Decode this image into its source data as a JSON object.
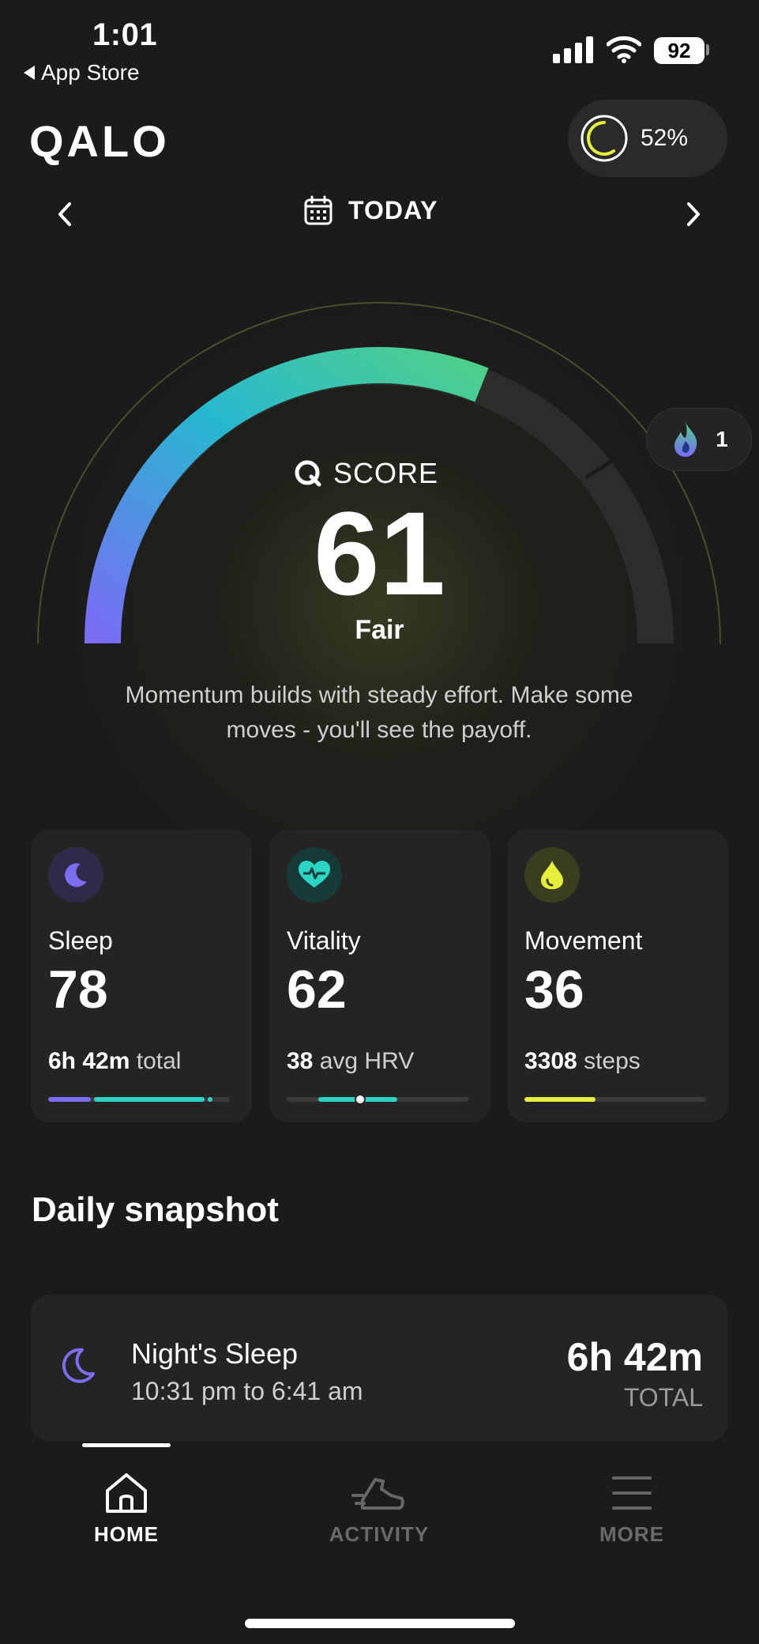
{
  "status_bar": {
    "time": "1:01",
    "back_label": "App Store",
    "battery": "92"
  },
  "header": {
    "logo": "QALO",
    "ring_percent": "52%"
  },
  "date_nav": {
    "label": "TODAY"
  },
  "score": {
    "label": "SCORE",
    "value": "61",
    "rating": "Fair",
    "message": "Momentum builds with steady effort. Make some moves - you'll see the payoff.",
    "streak": "1"
  },
  "cards": [
    {
      "title": "Sleep",
      "value": "78",
      "sub_value": "6h 42m",
      "sub_unit": "total",
      "icon": "moon-icon",
      "color": "#7b6df0"
    },
    {
      "title": "Vitality",
      "value": "62",
      "sub_value": "38",
      "sub_unit": "avg HRV",
      "icon": "heart-pulse-icon",
      "color": "#2bd4c4"
    },
    {
      "title": "Movement",
      "value": "36",
      "sub_value": "3308",
      "sub_unit": "steps",
      "icon": "drop-icon",
      "color": "#e6f03c"
    }
  ],
  "snapshot": {
    "title": "Daily snapshot",
    "item_name": "Night's Sleep",
    "item_time": "10:31 pm to 6:41 am",
    "item_total": "6h 42m",
    "item_total_label": "TOTAL"
  },
  "nav": {
    "home": "HOME",
    "activity": "ACTIVITY",
    "more": "MORE"
  },
  "colors": {
    "background": "#1b1b1b",
    "card": "#242424",
    "gauge_start": "#7a6cf5",
    "gauge_mid": "#27b8d0",
    "gauge_end": "#4fd08a"
  }
}
